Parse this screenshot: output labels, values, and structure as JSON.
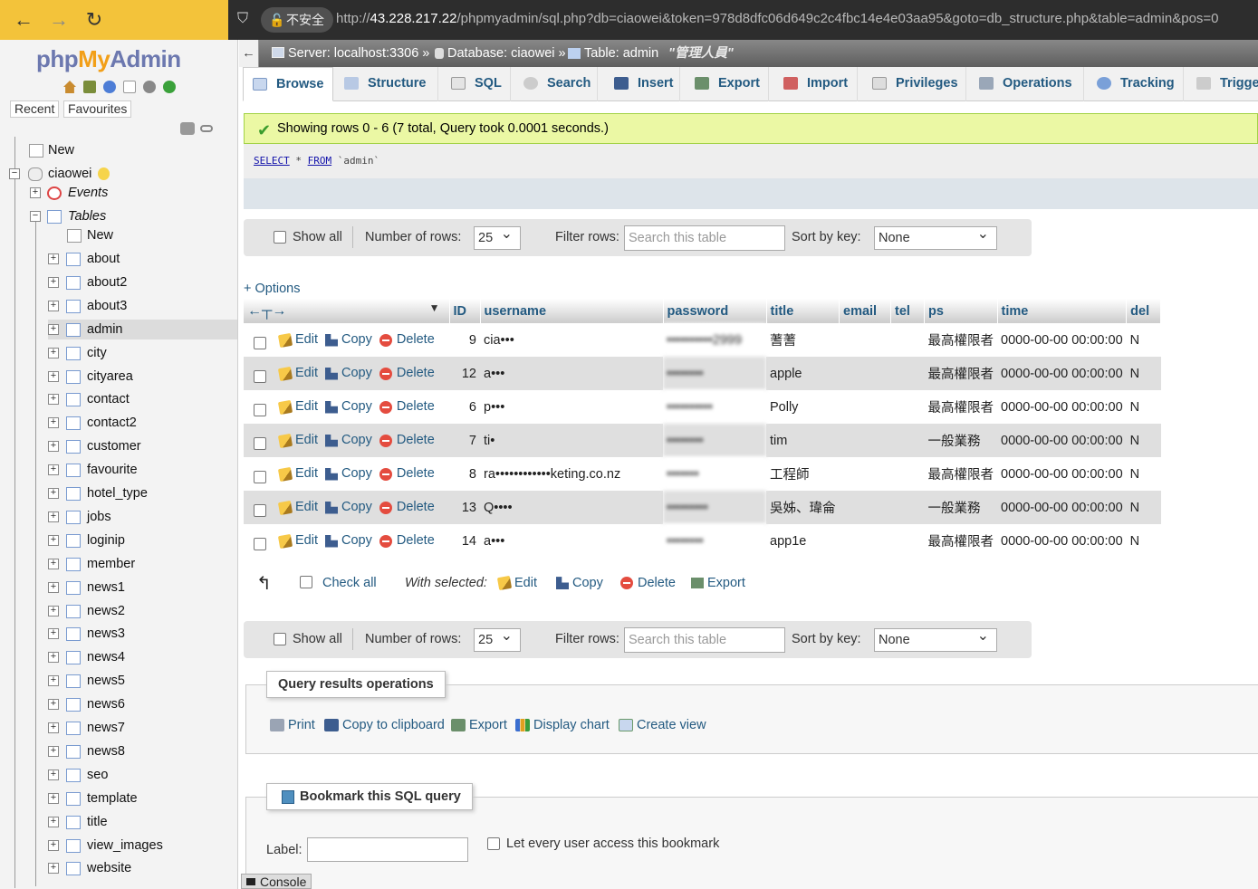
{
  "browser": {
    "insecure_label": "不安全",
    "url_prefix": "http://",
    "url_host": "43.228.217.22",
    "url_path": "/phpmyadmin/sql.php?db=ciaowei&token=978d8dfc06d649c2c4fbc14e4e03aa95&goto=db_structure.php&table=admin&pos=0"
  },
  "sidebar": {
    "logo_php": "php",
    "logo_my": "My",
    "logo_admin": "Admin",
    "recent": "Recent",
    "favourites": "Favourites",
    "new_label": "New",
    "db_name": "ciaowei",
    "events_label": "Events",
    "tables_label": "Tables",
    "tables_new": "New",
    "tables": [
      "about",
      "about2",
      "about3",
      "admin",
      "city",
      "cityarea",
      "contact",
      "contact2",
      "customer",
      "favourite",
      "hotel_type",
      "jobs",
      "loginip",
      "member",
      "news1",
      "news2",
      "news3",
      "news4",
      "news5",
      "news6",
      "news7",
      "news8",
      "seo",
      "template",
      "title",
      "view_images",
      "website"
    ]
  },
  "breadcrumb": {
    "server": "Server: localhost:3306 »",
    "database": "Database: ciaowei »",
    "table": "Table: admin",
    "comment": "\"管理人員\""
  },
  "tabs": [
    "Browse",
    "Structure",
    "SQL",
    "Search",
    "Insert",
    "Export",
    "Import",
    "Privileges",
    "Operations",
    "Tracking",
    "Trigge"
  ],
  "success_msg": "Showing rows 0 - 6 (7 total, Query took 0.0001 seconds.)",
  "sql": {
    "select": "SELECT",
    "star": " * ",
    "from": "FROM",
    "table": " `admin`"
  },
  "nav": {
    "show_all": "Show all",
    "num_rows_label": "Number of rows:",
    "num_rows_value": "25",
    "filter_label": "Filter rows:",
    "filter_placeholder": "Search this table",
    "sort_label": "Sort by key:",
    "sort_value": "None"
  },
  "options_link": "+ Options",
  "columns": [
    "ID",
    "username",
    "password",
    "title",
    "email",
    "tel",
    "ps",
    "time",
    "del"
  ],
  "actions": {
    "edit": "Edit",
    "copy": "Copy",
    "delete": "Delete"
  },
  "rows": [
    {
      "id": "9",
      "username": "cia•••",
      "password": "••••••••••2999",
      "title": "蓍蓍",
      "email": "",
      "tel": "",
      "ps": "最高權限者",
      "time": "0000-00-00 00:00:00",
      "del": "N"
    },
    {
      "id": "12",
      "username": "a•••",
      "password": "••••••••",
      "title": "apple",
      "email": "",
      "tel": "",
      "ps": "最高權限者",
      "time": "0000-00-00 00:00:00",
      "del": "N"
    },
    {
      "id": "6",
      "username": "p•••",
      "password": "••••••••••",
      "title": "Polly",
      "email": "",
      "tel": "",
      "ps": "最高權限者",
      "time": "0000-00-00 00:00:00",
      "del": "N"
    },
    {
      "id": "7",
      "username": "ti•",
      "password": "••••••••",
      "title": "tim",
      "email": "",
      "tel": "",
      "ps": "一般業務",
      "time": "0000-00-00 00:00:00",
      "del": "N"
    },
    {
      "id": "8",
      "username": "ra••••••••••••keting.co.nz",
      "password": "•••••••",
      "title": "工程師",
      "email": "",
      "tel": "",
      "ps": "最高權限者",
      "time": "0000-00-00 00:00:00",
      "del": "N"
    },
    {
      "id": "13",
      "username": "Q••••",
      "password": "•••••••••",
      "title": "吳姊、瑋侖",
      "email": "",
      "tel": "",
      "ps": "一般業務",
      "time": "0000-00-00 00:00:00",
      "del": "N"
    },
    {
      "id": "14",
      "username": "a•••",
      "password": "••••••••",
      "title": "app1e",
      "email": "",
      "tel": "",
      "ps": "最高權限者",
      "time": "0000-00-00 00:00:00",
      "del": "N"
    }
  ],
  "with_selected": {
    "check_all": "Check all",
    "label": "With selected:",
    "edit": "Edit",
    "copy": "Copy",
    "delete": "Delete",
    "export": "Export"
  },
  "query_ops": {
    "legend": "Query results operations",
    "print": "Print",
    "copy": "Copy to clipboard",
    "export": "Export",
    "chart": "Display chart",
    "view": "Create view"
  },
  "bookmark": {
    "legend": "Bookmark this SQL query",
    "label": "Label:",
    "share": "Let every user access this bookmark"
  },
  "console": "Console"
}
